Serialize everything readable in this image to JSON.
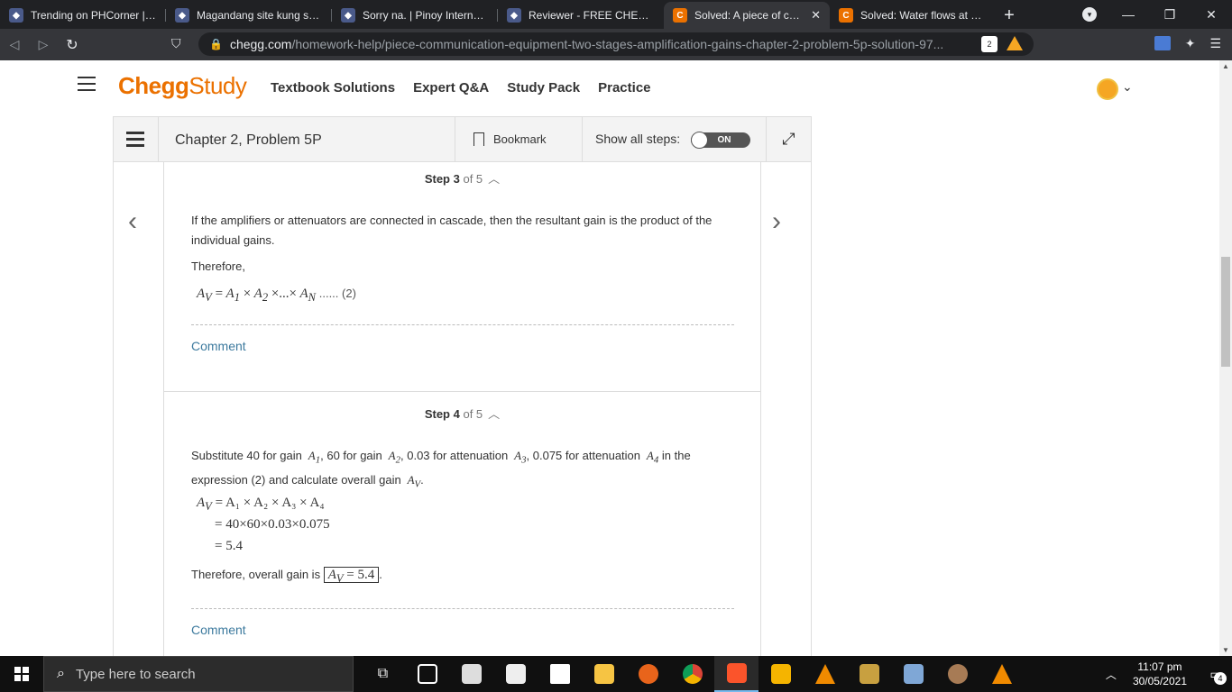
{
  "browser": {
    "tabs": [
      {
        "title": "Trending on PHCorner | Pin",
        "icon": "shield-icon",
        "active": false
      },
      {
        "title": "Magandang site kung saan",
        "icon": "shield-icon",
        "active": false
      },
      {
        "title": "Sorry na. | Pinoy Internet an",
        "icon": "shield-icon",
        "active": false
      },
      {
        "title": "Reviewer - FREE CHEGG UN",
        "icon": "shield-icon",
        "active": false
      },
      {
        "title": "Solved: A piece of comm",
        "icon": "chegg-icon",
        "active": true
      },
      {
        "title": "Solved: Water flows at a rat",
        "icon": "chegg-icon",
        "active": false
      }
    ],
    "new_tab": "+",
    "url_host": "chegg.com",
    "url_path": "/homework-help/piece-communication-equipment-two-stages-amplification-gains-chapter-2-problem-5p-solution-97...",
    "brave_badge": "2"
  },
  "header": {
    "logo_part1": "Chegg",
    "logo_part2": "Study",
    "nav": [
      "Textbook Solutions",
      "Expert Q&A",
      "Study Pack",
      "Practice"
    ]
  },
  "solution_bar": {
    "chapter": "Chapter 2, Problem 5P",
    "bookmark": "Bookmark",
    "show_all_steps": "Show all steps:",
    "toggle_state": "ON"
  },
  "step3": {
    "label": "Step 3",
    "of": "of 5",
    "text1": "If the amplifiers or attenuators are connected in cascade, then the resultant gain is the product of the individual gains.",
    "text2": "Therefore,",
    "equation": "A",
    "eq_full": "A_V = A_1 × A_2 ×...× A_N",
    "eq_number": "(2)",
    "comment": "Comment"
  },
  "step4": {
    "label": "Step 4",
    "of": "of 5",
    "text1_a": "Substitute 40 for gain",
    "text1_b": ", 60 for gain",
    "text1_c": ", 0.03 for attenuation",
    "text1_d": ", 0.075 for attenuation",
    "text1_e": "in the expression (2) and calculate overall gain",
    "line1": "= A₁ × A₂ × A₃ × A₄",
    "line2": "= 40×60×0.03×0.075",
    "line3": "= 5.4",
    "conclusion": "Therefore, overall gain is",
    "boxed": "= 5.4",
    "comment": "Comment"
  },
  "taskbar": {
    "search_placeholder": "Type here to search",
    "time": "11:07 pm",
    "date": "30/05/2021",
    "notifications": "4"
  },
  "colors": {
    "chegg_orange": "#eb7100",
    "comment_link": "#3d7a9e",
    "chrome_dark": "#202124"
  }
}
